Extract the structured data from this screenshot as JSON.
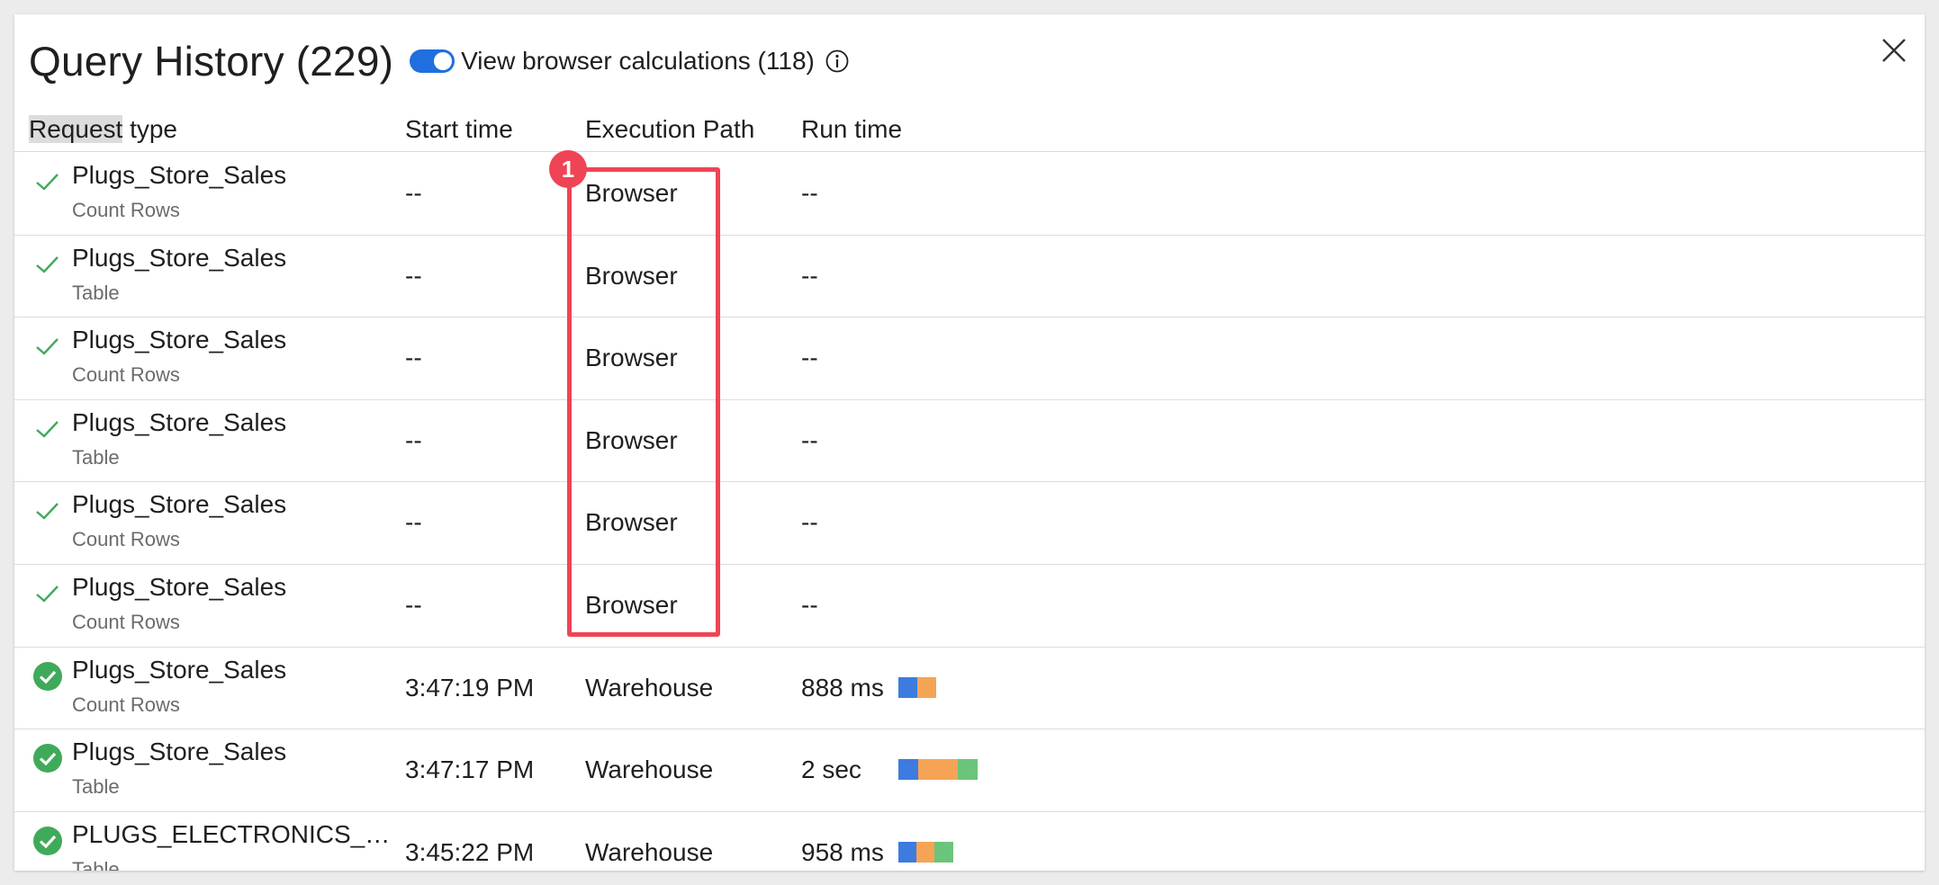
{
  "header": {
    "title": "Query History (229)",
    "toggle_label": "View browser calculations (118)",
    "toggle_on": true
  },
  "columns": {
    "request_type_hl": "Request",
    "request_type_rest": " type",
    "start_time": "Start time",
    "execution_path": "Execution Path",
    "run_time": "Run time"
  },
  "annotation": {
    "badge_number": "1",
    "color": "#ef4455"
  },
  "colors": {
    "accent": "#1f6fe0",
    "success": "#3faa5a",
    "bar_blue": "#3d7be0",
    "bar_orange": "#f5a455",
    "bar_green": "#6bc47b"
  },
  "rows": [
    {
      "name": "Plugs_Store_Sales",
      "subtype": "Count Rows",
      "start_time": "--",
      "execution_path": "Browser",
      "run_time": "--",
      "status": "check"
    },
    {
      "name": "Plugs_Store_Sales",
      "subtype": "Table",
      "start_time": "--",
      "execution_path": "Browser",
      "run_time": "--",
      "status": "check"
    },
    {
      "name": "Plugs_Store_Sales",
      "subtype": "Count Rows",
      "start_time": "--",
      "execution_path": "Browser",
      "run_time": "--",
      "status": "check"
    },
    {
      "name": "Plugs_Store_Sales",
      "subtype": "Table",
      "start_time": "--",
      "execution_path": "Browser",
      "run_time": "--",
      "status": "check"
    },
    {
      "name": "Plugs_Store_Sales",
      "subtype": "Count Rows",
      "start_time": "--",
      "execution_path": "Browser",
      "run_time": "--",
      "status": "check"
    },
    {
      "name": "Plugs_Store_Sales",
      "subtype": "Count Rows",
      "start_time": "--",
      "execution_path": "Browser",
      "run_time": "--",
      "status": "check"
    },
    {
      "name": "Plugs_Store_Sales",
      "subtype": "Count Rows",
      "start_time": "3:47:19 PM",
      "execution_path": "Warehouse",
      "run_time": "888 ms",
      "status": "check-circle",
      "timing": [
        {
          "phase": "blue",
          "share": 0.5
        },
        {
          "phase": "orange",
          "share": 0.5
        }
      ]
    },
    {
      "name": "Plugs_Store_Sales",
      "subtype": "Table",
      "start_time": "3:47:17 PM",
      "execution_path": "Warehouse",
      "run_time": "2 sec",
      "status": "check-circle",
      "timing": [
        {
          "phase": "blue",
          "share": 0.25
        },
        {
          "phase": "orange",
          "share": 0.5
        },
        {
          "phase": "green",
          "share": 0.25
        }
      ]
    },
    {
      "name": "PLUGS_ELECTRONICS_HAND...",
      "subtype": "Table",
      "start_time": "3:45:22 PM",
      "execution_path": "Warehouse",
      "run_time": "958 ms",
      "status": "check-circle",
      "timing": [
        {
          "phase": "blue",
          "share": 0.33
        },
        {
          "phase": "orange",
          "share": 0.33
        },
        {
          "phase": "green",
          "share": 0.34
        }
      ]
    }
  ]
}
